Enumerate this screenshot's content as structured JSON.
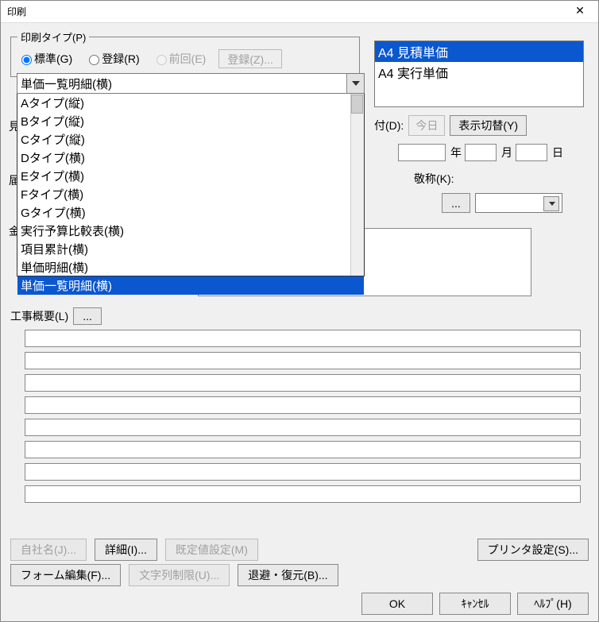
{
  "window": {
    "title": "印刷"
  },
  "printType": {
    "legend": "印刷タイプ(P)",
    "radios": {
      "standard": "標準(G)",
      "register": "登録(R)",
      "previous": "前回(E)"
    },
    "registerBtn": "登録(Z)..."
  },
  "combo": {
    "selected": "単価一覧明細(横)",
    "items": [
      "Aタイプ(縦)",
      "Bタイプ(縦)",
      "Cタイプ(縦)",
      "Dタイプ(横)",
      "Eタイプ(横)",
      "Fタイプ(横)",
      "Gタイプ(横)",
      "実行予算比較表(横)",
      "項目累計(横)",
      "単価明細(横)",
      "単価一覧明細(横)"
    ],
    "selectedIndex": 10
  },
  "centerList": {
    "items": [
      "A4 見積単価",
      "A4 実行単価"
    ],
    "selectedIndex": 0
  },
  "dateRow": {
    "label": "付(D):",
    "todayBtn": "今日",
    "swapBtn": "表示切替(Y)"
  },
  "dateUnits": {
    "y": "年",
    "m": "月",
    "d": "日"
  },
  "honorific": {
    "label": "敬称(K):"
  },
  "sideChars": {
    "mi": "見",
    "to": "届",
    "kin": "金"
  },
  "kouji": {
    "legend": "工事概要(L)",
    "dots": "..."
  },
  "dotsOnly": {
    "dots": "..."
  },
  "buttons": {
    "company": "自社名(J)...",
    "detail": "詳細(I)...",
    "defaults": "既定値設定(M)",
    "printer": "プリンタ設定(S)...",
    "formEdit": "フォーム編集(F)...",
    "strLimit": "文字列制限(U)...",
    "saveRestore": "退避・復元(B)...",
    "ok": "OK",
    "cancel": "ｷｬﾝｾﾙ",
    "help": "ﾍﾙﾌﾟ(H)"
  }
}
